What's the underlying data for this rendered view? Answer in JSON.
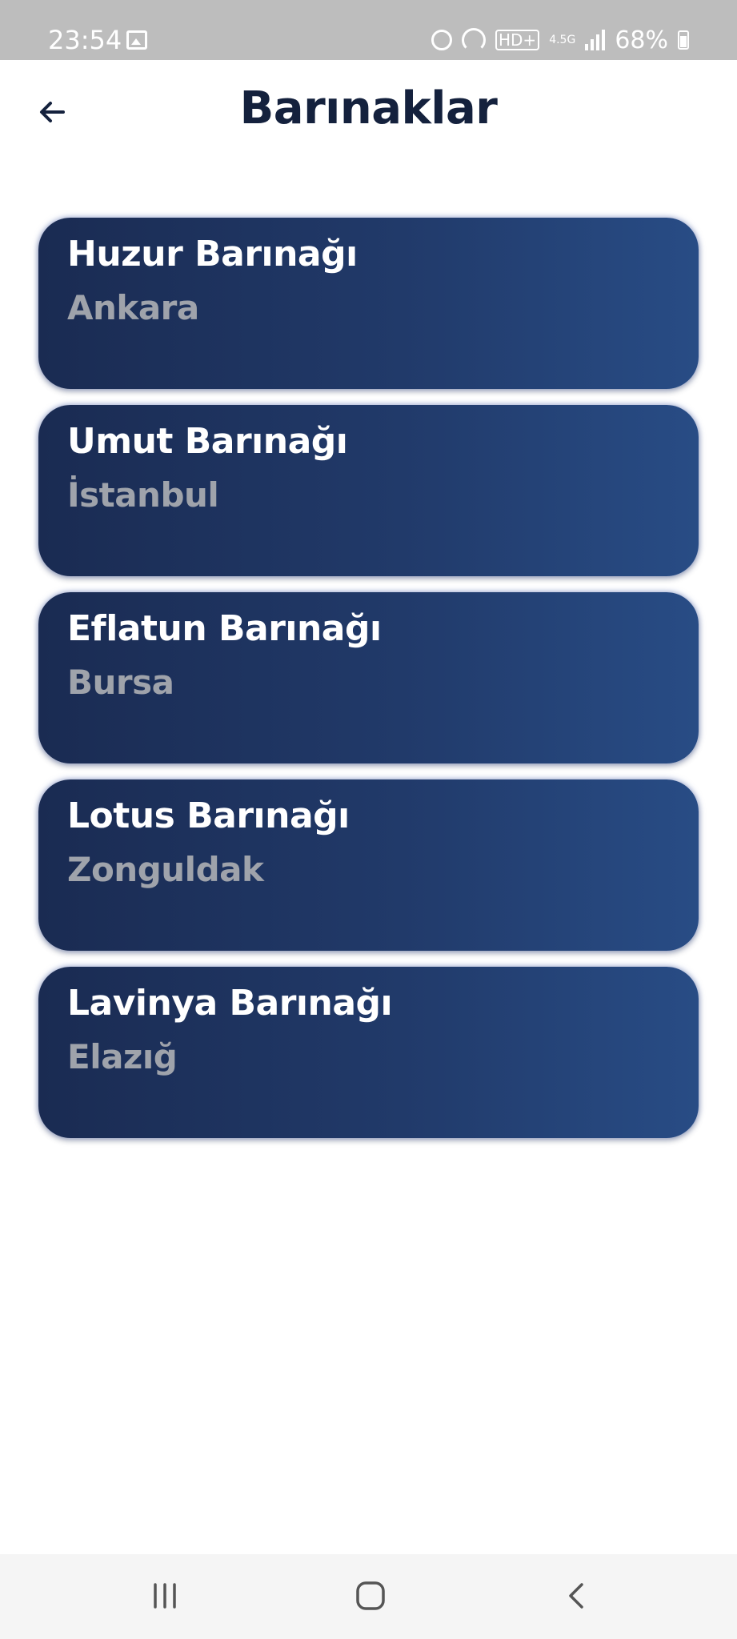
{
  "status_bar": {
    "time": "23:54",
    "network_label": "4.5G",
    "hd_label": "HD+",
    "battery": "68%"
  },
  "header": {
    "title": "Barınaklar"
  },
  "shelters": [
    {
      "name": "Huzur Barınağı",
      "city": "Ankara"
    },
    {
      "name": "Umut Barınağı",
      "city": "İstanbul"
    },
    {
      "name": "Eflatun Barınağı",
      "city": "Bursa"
    },
    {
      "name": "Lotus Barınağı",
      "city": "Zonguldak"
    },
    {
      "name": "Lavinya Barınağı",
      "city": "Elazığ"
    }
  ],
  "colors": {
    "title": "#14213d",
    "card_start": "#1a2b52",
    "card_end": "#284c85",
    "city_text": "#9fa3ab",
    "status_bar_bg": "#bdbdbd"
  },
  "icons": {
    "back": "arrow-left-icon",
    "recents": "recents-icon",
    "home": "home-icon",
    "nav_back": "chevron-left-icon"
  }
}
